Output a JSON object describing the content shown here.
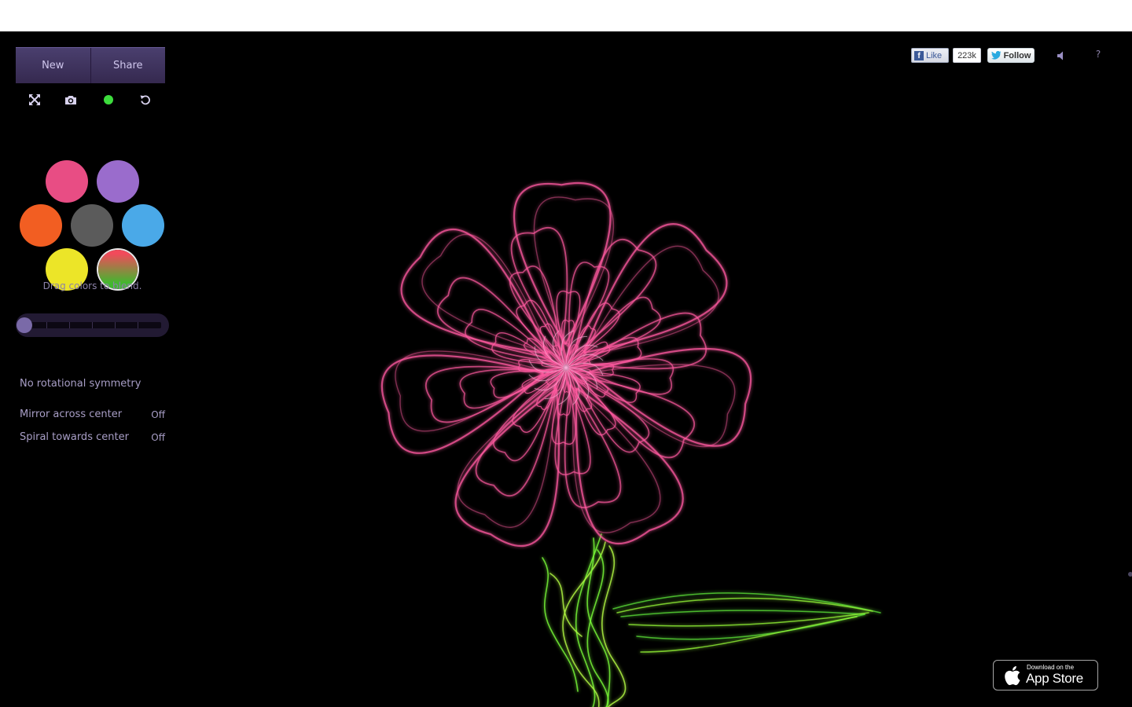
{
  "toolbar": {
    "new_label": "New",
    "share_label": "Share",
    "tools": [
      "fullscreen-icon",
      "camera-icon",
      "brush-dot-icon",
      "undo-icon"
    ],
    "brush_dot_color": "#3ddc3d"
  },
  "palette": {
    "swatches": [
      {
        "name": "pink",
        "color": "#e84d84"
      },
      {
        "name": "purple",
        "color": "#9a6ccc"
      },
      {
        "name": "orange",
        "color": "#f25e22"
      },
      {
        "name": "gray",
        "color": "#5b5b5b"
      },
      {
        "name": "blue",
        "color": "#4aa9e8"
      },
      {
        "name": "yellow",
        "color": "#ece528"
      },
      {
        "name": "blend",
        "colors": [
          "#f24a5b",
          "#41b82e"
        ],
        "selected": true
      }
    ],
    "hint": "Drag colors to blend."
  },
  "symmetry": {
    "label": "No rotational symmetry",
    "slider_value": 0
  },
  "options": [
    {
      "label": "Mirror across center",
      "value": "Off"
    },
    {
      "label": "Spiral towards center",
      "value": "Off"
    }
  ],
  "social": {
    "like_label": "Like",
    "like_count": "223k",
    "follow_label": "Follow"
  },
  "help_label": "?",
  "appstore": {
    "line1": "Download on the",
    "line2": "App Store"
  },
  "colors": {
    "panel_accent": "#4a3f6e",
    "petal": "#ff5aa0",
    "stem": "#7cff3a"
  }
}
